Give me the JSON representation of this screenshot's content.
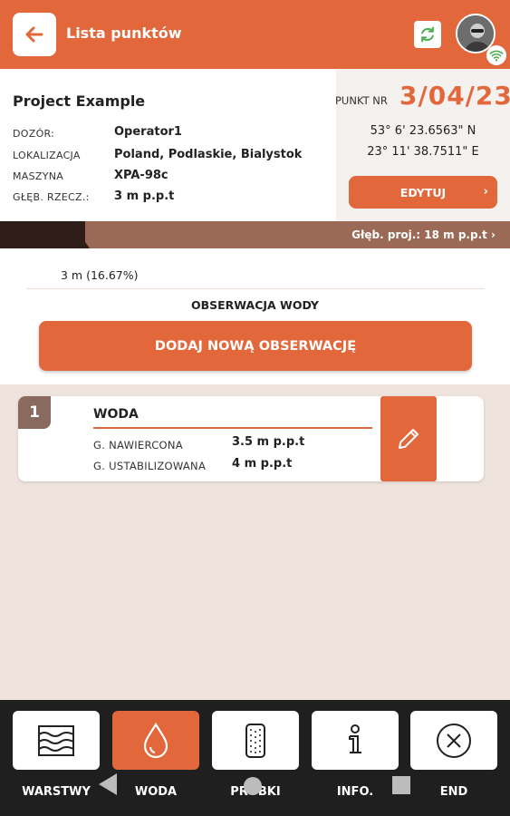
{
  "colors": {
    "accent": "#e2673b",
    "dark_bar": "#2e1d18",
    "bar": "#9a6a56",
    "badge": "#8a6a5e",
    "background": "#efe4dd"
  },
  "header": {
    "title": "Lista punktów",
    "icons": {
      "back": "arrow-left-icon",
      "sync": "sync-icon",
      "avatar": "avatar",
      "wifi": "wifi-icon"
    }
  },
  "project": {
    "name": "Project Example",
    "fields": [
      {
        "label": "DOZÓR:",
        "value": "Operator1"
      },
      {
        "label": "LOKALIZACJA",
        "value": "Poland, Podlaskie, Bialystok"
      },
      {
        "label": "MASZYNA",
        "value": "XPA-98c"
      },
      {
        "label": "GŁĘB. RZECZ.:",
        "value": "3 m p.p.t"
      }
    ]
  },
  "point": {
    "label": "PUNKT NR",
    "number": "3/04/23",
    "lat": "53° 6' 23.6563\" N",
    "lon": "23° 11' 38.7511\" E",
    "edit_label": "EDYTUJ",
    "edit_chevron": "›"
  },
  "depth": {
    "projected_label": "Głęb. proj.: 18 m p.p.t ›",
    "current_label": "3 m (16.67%)",
    "fraction": 0.1667
  },
  "observations": {
    "heading": "OBSERWACJA WODY",
    "add_label": "DODAJ NOWĄ OBSERWACJĘ",
    "items": [
      {
        "index": "1",
        "title": "WODA",
        "rows": [
          {
            "label": "G. NAWIERCONA",
            "value": "3.5 m p.p.t"
          },
          {
            "label": "G. USTABILIZOWANA",
            "value": "4 m p.p.t"
          }
        ]
      }
    ]
  },
  "bottom_nav": [
    {
      "label": "WARSTWY",
      "icon": "layers-icon",
      "active": false
    },
    {
      "label": "WODA",
      "icon": "water-drop-icon",
      "active": true
    },
    {
      "label": "PRÓBKI",
      "icon": "sample-jar-icon",
      "active": false
    },
    {
      "label": "INFO.",
      "icon": "info-icon",
      "active": false
    },
    {
      "label": "END",
      "icon": "close-circle-icon",
      "active": false
    }
  ]
}
